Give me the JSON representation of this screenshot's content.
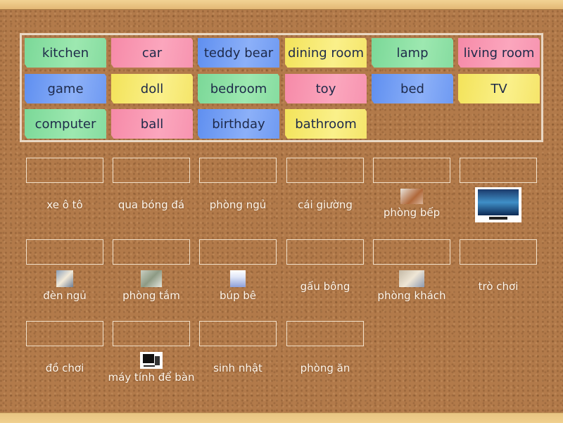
{
  "bank": {
    "cards": [
      {
        "text": "kitchen",
        "color": "green"
      },
      {
        "text": "car",
        "color": "pink"
      },
      {
        "text": "teddy bear",
        "color": "blue"
      },
      {
        "text": "dining room",
        "color": "yellow"
      },
      {
        "text": "lamp",
        "color": "green"
      },
      {
        "text": "living room",
        "color": "pink"
      },
      {
        "text": "game",
        "color": "blue"
      },
      {
        "text": "doll",
        "color": "yellow"
      },
      {
        "text": "bedroom",
        "color": "green"
      },
      {
        "text": "toy",
        "color": "pink"
      },
      {
        "text": "bed",
        "color": "blue"
      },
      {
        "text": "TV",
        "color": "yellow"
      },
      {
        "text": "computer",
        "color": "green"
      },
      {
        "text": "ball",
        "color": "pink"
      },
      {
        "text": "birthday",
        "color": "blue"
      },
      {
        "text": "bathroom",
        "color": "yellow"
      }
    ]
  },
  "targets": [
    {
      "label": "xe ô tô",
      "image": null
    },
    {
      "label": "qua bóng đá",
      "image": null
    },
    {
      "label": "phòng ngủ",
      "image": null
    },
    {
      "label": "cái giường",
      "image": null
    },
    {
      "label": "phòng bếp",
      "image": "kitchen-photo"
    },
    {
      "label": "",
      "image": "tv-photo"
    },
    {
      "label": "đèn ngủ",
      "image": "lamp-photo"
    },
    {
      "label": "phòng tắm",
      "image": "bathroom-photo"
    },
    {
      "label": "búp bê",
      "image": "doll-photo"
    },
    {
      "label": "gấu bông",
      "image": null
    },
    {
      "label": "phòng khách",
      "image": "living-room-photo"
    },
    {
      "label": "trò chơi",
      "image": null
    },
    {
      "label": "đồ chơi",
      "image": null
    },
    {
      "label": "máy tính để bàn",
      "image": "computer-photo"
    },
    {
      "label": "sinh nhật",
      "image": null
    },
    {
      "label": "phòng ăn",
      "image": null
    }
  ],
  "colors": {
    "green": "#8ee0a6",
    "pink": "#f99ab4",
    "blue": "#7aa2f4",
    "yellow": "#f6e870",
    "cork": "#b27a4a",
    "frame": "#ecc988"
  }
}
